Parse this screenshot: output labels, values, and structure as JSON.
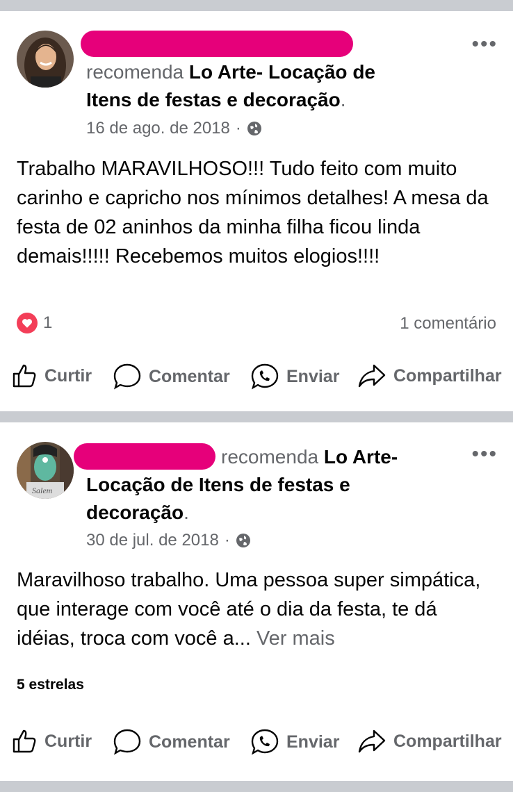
{
  "posts": [
    {
      "verb": "recomenda",
      "page": "Lo Arte- Locação de Itens de festas e decoração",
      "page_line1": "Lo Arte- Locação de",
      "page_line2": "Itens de festas e decoração",
      "period": ".",
      "date": "16 de ago. de 2018",
      "date_sep": "·",
      "body": "Trabalho MARAVILHOSO!!! Tudo feito com muito carinho e capricho nos mínimos detalhes! A mesa da festa de 02 aninhos da minha filha ficou linda demais!!!!! Recebemos muitos elogios!!!!",
      "reactions_count": "1",
      "comments_label": "1 comentário",
      "more_icon": "more-dots-icon",
      "privacy_icon": "globe-icon"
    },
    {
      "verb": "recomenda",
      "page": "Lo Arte- Locação de Itens de festas e decoração",
      "page_line1": "Lo Arte-",
      "page_line2": "Locação de Itens de festas e",
      "page_line3": "decoração",
      "period": ".",
      "date": "30 de jul. de 2018",
      "date_sep": "·",
      "body": "Maravilhoso trabalho. Uma pessoa super simpática, que interage com você até o dia da festa, te dá idéias, troca com você a...",
      "see_more": "Ver mais",
      "rating": "5 estrelas",
      "more_icon": "more-dots-icon",
      "privacy_icon": "globe-icon"
    }
  ],
  "actions": {
    "like": "Curtir",
    "comment": "Comentar",
    "send": "Enviar",
    "share": "Compartilhar"
  },
  "colors": {
    "redaction": "#e6007a",
    "secondary_text": "#65676b",
    "love_reaction": "#f33e58",
    "separator": "#c9ccd1"
  }
}
